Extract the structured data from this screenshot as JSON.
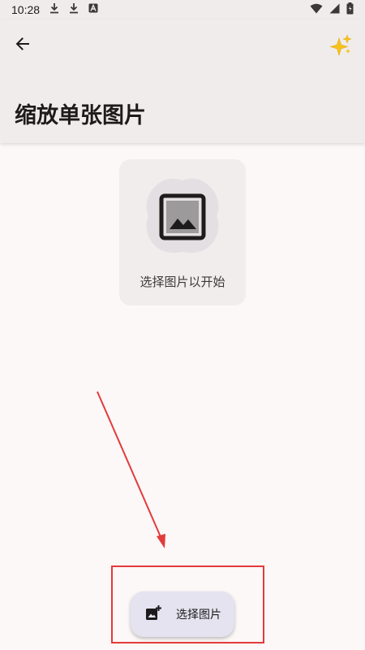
{
  "status_bar": {
    "time": "10:28",
    "icons_left": [
      "download-icon",
      "download-icon",
      "accessibility-icon"
    ],
    "icons_right": [
      "wifi-icon",
      "signal-icon",
      "battery-icon"
    ]
  },
  "app_bar": {
    "title": "缩放单张图片",
    "back_icon": "arrow-back-icon",
    "action_icon": "sparkles-icon"
  },
  "picker": {
    "prompt": "选择图片以开始",
    "icon": "image-icon"
  },
  "fab": {
    "label": "选择图片",
    "icon": "add-photo-icon"
  },
  "annotation": {
    "color": "#e23b3b"
  },
  "colors": {
    "background": "#fcf8f7",
    "app_bar": "#f0eceb",
    "card": "#f1eded",
    "fab": "#e4e3ef"
  }
}
